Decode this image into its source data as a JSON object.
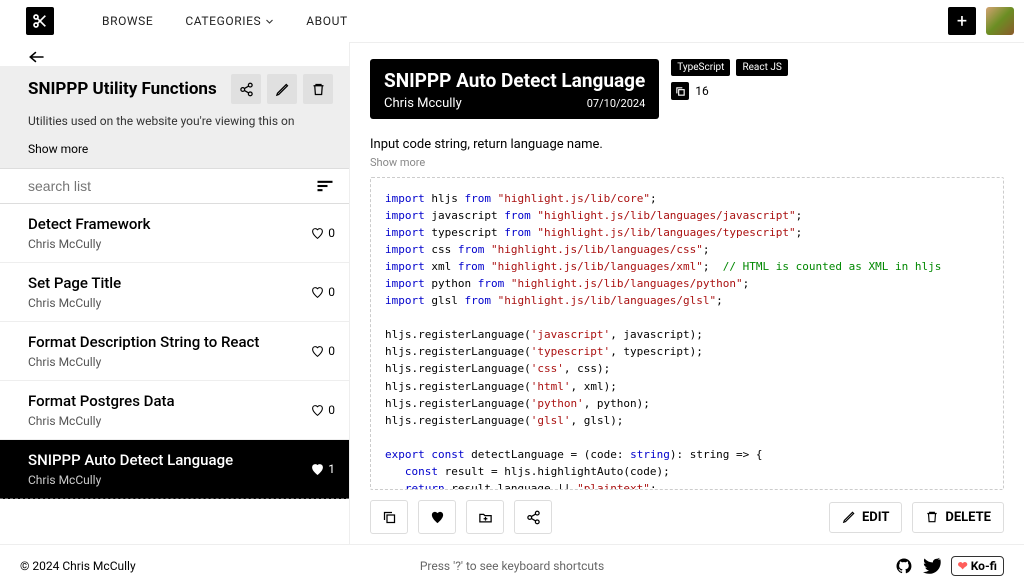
{
  "nav": {
    "browse": "BROWSE",
    "categories": "CATEGORIES",
    "about": "ABOUT"
  },
  "list": {
    "title": "SNIPPP Utility Functions",
    "description": "Utilities used on the website you're viewing this on",
    "show_more": "Show more",
    "search_placeholder": "search list"
  },
  "snippets": [
    {
      "title": "Detect Framework",
      "author": "Chris McCully",
      "fav": "0",
      "active": false
    },
    {
      "title": "Set Page Title",
      "author": "Chris McCully",
      "fav": "0",
      "active": false
    },
    {
      "title": "Format Description String to React",
      "author": "Chris McCully",
      "fav": "0",
      "active": false
    },
    {
      "title": "Format Postgres Data",
      "author": "Chris McCully",
      "fav": "0",
      "active": false
    },
    {
      "title": "SNIPPP Auto Detect Language",
      "author": "Chris McCully",
      "fav": "1",
      "active": true
    }
  ],
  "detail": {
    "title": "SNIPPP Auto Detect Language",
    "author": "Chris Mccully",
    "date": "07/10/2024",
    "tags": [
      "TypeScript",
      "React JS"
    ],
    "forks": "16",
    "description": "Input code string, return language name.",
    "show_more": "Show more",
    "edit": "EDIT",
    "delete": "DELETE"
  },
  "code": {
    "s1": "\"highlight.js/lib/core\"",
    "s2": "\"highlight.js/lib/languages/javascript\"",
    "s3": "\"highlight.js/lib/languages/typescript\"",
    "s4": "\"highlight.js/lib/languages/css\"",
    "s5": "\"highlight.js/lib/languages/xml\"",
    "s6": "\"highlight.js/lib/languages/python\"",
    "s7": "\"highlight.js/lib/languages/glsl\"",
    "c1": "// HTML is counted as XML in hljs",
    "r1": "hljs.registerLanguage(",
    "rjs": "'javascript'",
    "rjs2": ", javascript);",
    "rts": "'typescript'",
    "rts2": ", typescript);",
    "rcss": "'css'",
    "rcss2": ", css);",
    "rhtml": "'html'",
    "rhtml2": ", xml);",
    "rpy": "'python'",
    "rpy2": ", python);",
    "rglsl": "'glsl'",
    "rglsl2": ", glsl);",
    "fn_sig": " detectLanguage = (code: ",
    "fn_sig2": "): string => {",
    "fn_body1": " result = hljs.highlightAuto(code);",
    "fn_body2": " result.language || ",
    "plaintext": "\"plaintext\"",
    "close": "};"
  },
  "footer": {
    "copyright": "© 2024 Chris McCully",
    "hint": "Press '?' to see keyboard shortcuts",
    "kofi": "Ko-fi"
  }
}
